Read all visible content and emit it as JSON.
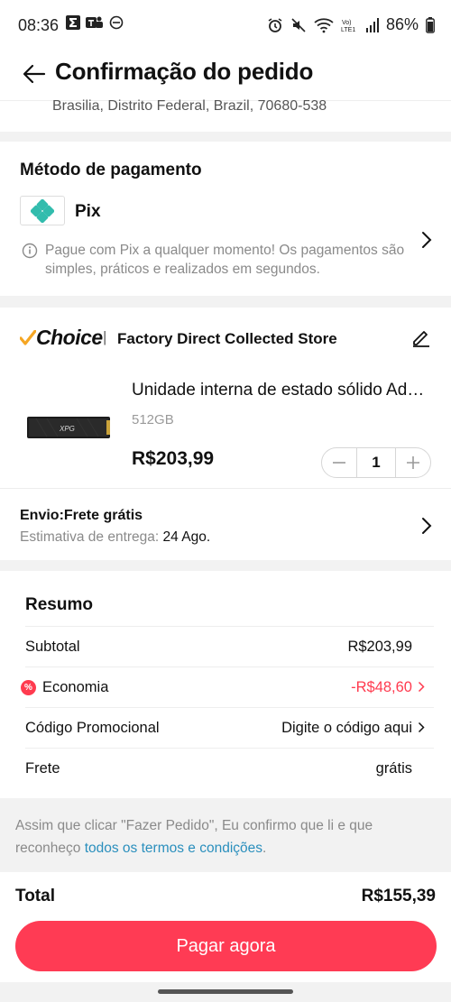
{
  "status_bar": {
    "time": "08:36",
    "battery": "86%"
  },
  "header": {
    "title": "Confirmação do pedido"
  },
  "address": {
    "line": "Brasilia, Distrito Federal, Brazil, 70680-538"
  },
  "payment": {
    "title": "Método de pagamento",
    "method": "Pix",
    "note": "Pague com Pix a qualquer momento! Os pagamentos são simples, práticos e realizados em segundos."
  },
  "store": {
    "badge": "Choice",
    "separator": "|",
    "name": "Factory Direct Collected Store",
    "product": {
      "title": "Unidade interna de estado sólido Ad…",
      "variant": "512GB",
      "price": "R$203,99",
      "quantity": "1"
    },
    "shipping_label": "Envio:Frete grátis",
    "delivery_prefix": "Estimativa de entrega:",
    "delivery_date": "24 Ago."
  },
  "summary": {
    "title": "Resumo",
    "rows": [
      {
        "label": "Subtotal",
        "value": "R$203,99"
      },
      {
        "label": "Economia",
        "value": "-R$48,60"
      },
      {
        "label": "Código Promocional",
        "value": "Digite o código aqui"
      },
      {
        "label": "Frete",
        "value": "grátis"
      }
    ]
  },
  "terms": {
    "prefix": "Assim que clicar \"Fazer Pedido\", Eu confirmo que li e que reconheço",
    "link": "todos os termos e condições",
    "suffix": "."
  },
  "footer": {
    "total_label": "Total",
    "total_value": "R$155,39",
    "pay_button": "Pagar agora"
  },
  "colors": {
    "accent": "#ff3b54",
    "discount": "#ff3b4f",
    "link": "#2a8fbd",
    "pix": "#32bcad",
    "choice_check": "#f5a623"
  }
}
